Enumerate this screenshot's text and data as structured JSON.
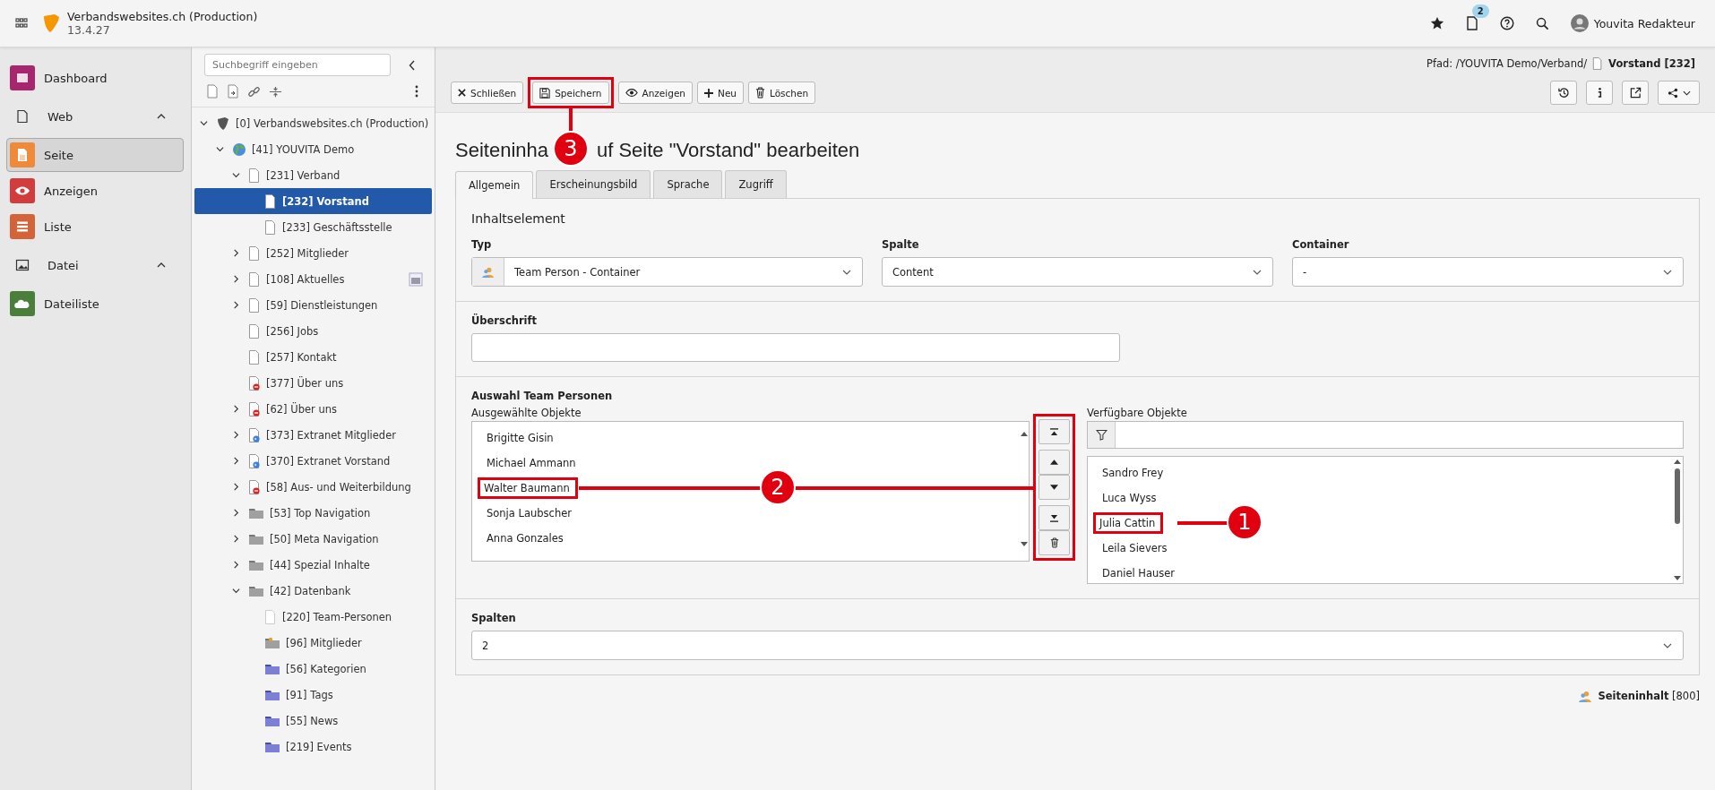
{
  "topbar": {
    "site_name": "Verbandswebsites.ch (Production)",
    "version": "13.4.27",
    "notification_count": "2",
    "user_name": "Youvita Redakteur"
  },
  "modules": [
    {
      "kind": "item",
      "label": "Dashboard",
      "color": "#a8266d",
      "selected": false
    },
    {
      "kind": "group",
      "label": "Web",
      "expanded": true,
      "children": [
        {
          "kind": "item",
          "label": "Seite",
          "color": "#ee8a3a",
          "selected": true
        },
        {
          "kind": "item",
          "label": "Anzeigen",
          "color": "#d23c3c",
          "selected": false
        },
        {
          "kind": "item",
          "label": "Liste",
          "color": "#d4633a",
          "selected": false
        }
      ]
    },
    {
      "kind": "group",
      "label": "Datei",
      "expanded": true,
      "children": [
        {
          "kind": "item",
          "label": "Dateiliste",
          "color": "#4a7f3b",
          "selected": false
        }
      ]
    }
  ],
  "page_tree": {
    "search_placeholder": "Suchbegriff eingeben",
    "nodes": [
      {
        "label": "[0] Verbandswebsites.ch (Production)",
        "kind": "site",
        "has_children": true,
        "expanded": true,
        "selected": false,
        "children": [
          {
            "label": "[41] YOUVITA Demo",
            "kind": "globe",
            "has_children": true,
            "expanded": true,
            "selected": false,
            "children": [
              {
                "label": "[231] Verband",
                "kind": "page",
                "has_children": true,
                "expanded": true,
                "selected": false,
                "children": [
                  {
                    "label": "[232] Vorstand",
                    "kind": "page",
                    "has_children": false,
                    "expanded": false,
                    "selected": true
                  },
                  {
                    "label": "[233] Geschäftsstelle",
                    "kind": "page",
                    "has_children": false,
                    "expanded": false,
                    "selected": false
                  }
                ]
              },
              {
                "label": "[252] Mitglieder",
                "kind": "page",
                "has_children": true,
                "expanded": false,
                "selected": false
              },
              {
                "label": "[108] Aktuelles",
                "kind": "page",
                "has_children": true,
                "expanded": false,
                "selected": false,
                "has_plugin": true
              },
              {
                "label": "[59] Dienstleistungen",
                "kind": "page",
                "has_children": true,
                "expanded": false,
                "selected": false
              },
              {
                "label": "[256] Jobs",
                "kind": "page",
                "has_children": false,
                "expanded": false,
                "selected": false
              },
              {
                "label": "[257] Kontakt",
                "kind": "page",
                "has_children": false,
                "expanded": false,
                "selected": false
              },
              {
                "label": "[377] Über uns",
                "kind": "hidden",
                "has_children": false,
                "expanded": false,
                "selected": false
              },
              {
                "label": "[62] Über uns",
                "kind": "hidden",
                "has_children": true,
                "expanded": false,
                "selected": false
              },
              {
                "label": "[373] Extranet Mitglieder",
                "kind": "shortcut",
                "has_children": true,
                "expanded": false,
                "selected": false
              },
              {
                "label": "[370] Extranet Vorstand",
                "kind": "shortcut",
                "has_children": true,
                "expanded": false,
                "selected": false
              },
              {
                "label": "[58] Aus- und Weiterbildung",
                "kind": "hidden",
                "has_children": true,
                "expanded": false,
                "selected": false
              },
              {
                "label": "[53] Top Navigation",
                "kind": "folder",
                "has_children": true,
                "expanded": false,
                "selected": false
              },
              {
                "label": "[50] Meta Navigation",
                "kind": "folder",
                "has_children": true,
                "expanded": false,
                "selected": false
              },
              {
                "label": "[44] Spezial Inhalte",
                "kind": "folder",
                "has_children": true,
                "expanded": false,
                "selected": false
              },
              {
                "label": "[42] Datenbank",
                "kind": "folder",
                "has_children": true,
                "expanded": true,
                "selected": false,
                "children": [
                  {
                    "label": "[220] Team-Personen",
                    "kind": "faint",
                    "has_children": false,
                    "expanded": false,
                    "selected": false
                  },
                  {
                    "label": "[96] Mitglieder",
                    "kind": "storage",
                    "has_children": false,
                    "expanded": false,
                    "selected": false
                  },
                  {
                    "label": "[56] Kategorien",
                    "kind": "sysfolder",
                    "has_children": false,
                    "expanded": false,
                    "selected": false
                  },
                  {
                    "label": "[91] Tags",
                    "kind": "sysfolder",
                    "has_children": false,
                    "expanded": false,
                    "selected": false
                  },
                  {
                    "label": "[55] News",
                    "kind": "sysfolder",
                    "has_children": false,
                    "expanded": false,
                    "selected": false
                  },
                  {
                    "label": "[219] Events",
                    "kind": "sysfolder",
                    "has_children": false,
                    "expanded": false,
                    "selected": false
                  }
                ]
              }
            ]
          }
        ]
      }
    ]
  },
  "path": {
    "prefix": "Pfad: /YOUVITA Demo/Verband/",
    "page": "Vorstand [232]"
  },
  "toolbar": [
    {
      "kind": "close",
      "label": "Schließen",
      "highlighted": false
    },
    {
      "kind": "save",
      "label": "Speichern",
      "highlighted": true
    },
    {
      "kind": "view",
      "label": "Anzeigen",
      "highlighted": false
    },
    {
      "kind": "new",
      "label": "Neu",
      "highlighted": false
    },
    {
      "kind": "delete",
      "label": "Löschen",
      "highlighted": false
    }
  ],
  "heading_parts": [
    "Seiteninha",
    "uf Seite \"Vorstand\" bearbeiten"
  ],
  "tabs": [
    {
      "label": "Allgemein",
      "selected": true
    },
    {
      "label": "Erscheinungsbild",
      "selected": false
    },
    {
      "label": "Sprache",
      "selected": false
    },
    {
      "label": "Zugriff",
      "selected": false
    }
  ],
  "section_title": "Inhaltselement",
  "selects": [
    {
      "label": "Typ",
      "value": "Team Person - Container",
      "with_icon": true
    },
    {
      "label": "Spalte",
      "value": "Content",
      "with_icon": false
    },
    {
      "label": "Container",
      "value": "-",
      "with_icon": false
    }
  ],
  "headline_field": {
    "label": "Überschrift"
  },
  "team_selection": {
    "title": "Auswahl Team Personen",
    "selected_label": "Ausgewählte Objekte",
    "available_label": "Verfügbare Objekte",
    "selected_items": [
      {
        "name": "Brigitte Gisin",
        "highlighted": false
      },
      {
        "name": "Michael Ammann",
        "highlighted": false
      },
      {
        "name": "Walter Baumann",
        "highlighted": true
      },
      {
        "name": "Sonja Laubscher",
        "highlighted": false
      },
      {
        "name": "Anna Gonzales",
        "highlighted": false
      }
    ],
    "buttons_highlighted": true,
    "available_items": [
      {
        "name": "Sandro Frey",
        "highlighted": false
      },
      {
        "name": "Luca Wyss",
        "highlighted": false
      },
      {
        "name": "Julia Cattin",
        "highlighted": true
      },
      {
        "name": "Leila Sievers",
        "highlighted": false
      },
      {
        "name": "Daniel Hauser",
        "highlighted": false
      }
    ]
  },
  "columns_field": {
    "label": "Spalten",
    "value": "2"
  },
  "footer": "**Seiteninhalt** [800]",
  "annotations": [
    {
      "number": "1"
    },
    {
      "number": "2"
    },
    {
      "number": "3"
    }
  ]
}
